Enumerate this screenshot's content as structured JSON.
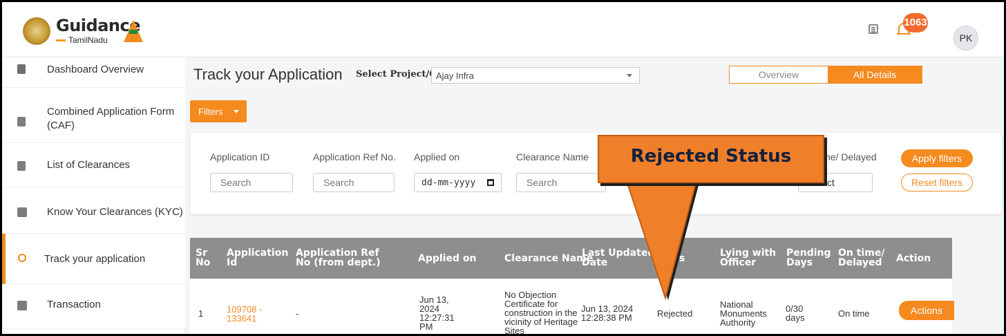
{
  "brand": {
    "title": "Guidance",
    "subtitle": "TamilNadu"
  },
  "header": {
    "notification_count": "1063",
    "avatar_initials": "PK"
  },
  "sidebar": {
    "items": [
      {
        "label": "Dashboard Overview",
        "icon": "dashboard-icon"
      },
      {
        "label": "Combined Application Form",
        "label2": "(CAF)",
        "icon": "document-icon"
      },
      {
        "label": "List of Clearances",
        "icon": "list-icon"
      },
      {
        "label": "Know Your Clearances (KYC)",
        "icon": "book-icon"
      },
      {
        "label": "Track your application",
        "icon": "location-icon",
        "active": true
      },
      {
        "label": "Transaction",
        "icon": "transaction-icon"
      }
    ]
  },
  "main": {
    "title": "Track your Application",
    "project_label": "Select Project/CAF",
    "project_value": "Ajay Infra",
    "tabs": {
      "overview": "Overview",
      "all_details": "All Details"
    },
    "filters_button": "Filters"
  },
  "filters": {
    "application_id": {
      "label": "Application ID",
      "placeholder": "Search"
    },
    "application_ref": {
      "label": "Application Ref No.",
      "placeholder": "Search"
    },
    "applied_on": {
      "label": "Applied on",
      "value": "dd-mm-yyyy"
    },
    "clearance_name": {
      "label": "Clearance Name",
      "placeholder": "Search"
    },
    "on_time_delayed": {
      "label": "ime/ Delayed",
      "value": "lect"
    },
    "apply": "Apply filters",
    "reset": "Reset filters"
  },
  "table": {
    "headers": {
      "sr_no_1": "Sr",
      "sr_no_2": "No",
      "app_id_1": "Application",
      "app_id_2": "Id",
      "app_ref_1": "Application Ref",
      "app_ref_2": "No (from dept.)",
      "applied_on": "Applied on",
      "clearance_name": "Clearance Name",
      "last_updated_1": "Last Updated",
      "last_updated_2": "Date",
      "status": "us",
      "lying_1": "Lying with",
      "lying_2": "Officer",
      "pending_1": "Pending",
      "pending_2": "Days",
      "ontime_1": "On time/",
      "ontime_2": "Delayed",
      "action": "Action"
    },
    "rows": [
      {
        "sr": "1",
        "app_id_1": "109708 -",
        "app_id_2": "133641",
        "app_ref": "-",
        "applied_1": "Jun 13,",
        "applied_2": "2024",
        "applied_3": "12:27:31",
        "applied_4": "PM",
        "clearance_1": "No Objection",
        "clearance_2": "Certificate for",
        "clearance_3": "construction in the",
        "clearance_4": "vicinity of Heritage",
        "clearance_5": "Sites",
        "updated_1": "Jun 13, 2024",
        "updated_2": "12:28:38 PM",
        "status": "Rejected",
        "lying_1": "National",
        "lying_2": "Monuments",
        "lying_3": "Authority",
        "pending_1": "0/30",
        "pending_2": "days",
        "ontime": "On time",
        "action": "Actions"
      }
    ]
  },
  "callout": {
    "text": "Rejected Status"
  },
  "colors": {
    "accent": "#f58a1f",
    "table_header": "#8e8e8e",
    "callout": "#f07f2a"
  }
}
